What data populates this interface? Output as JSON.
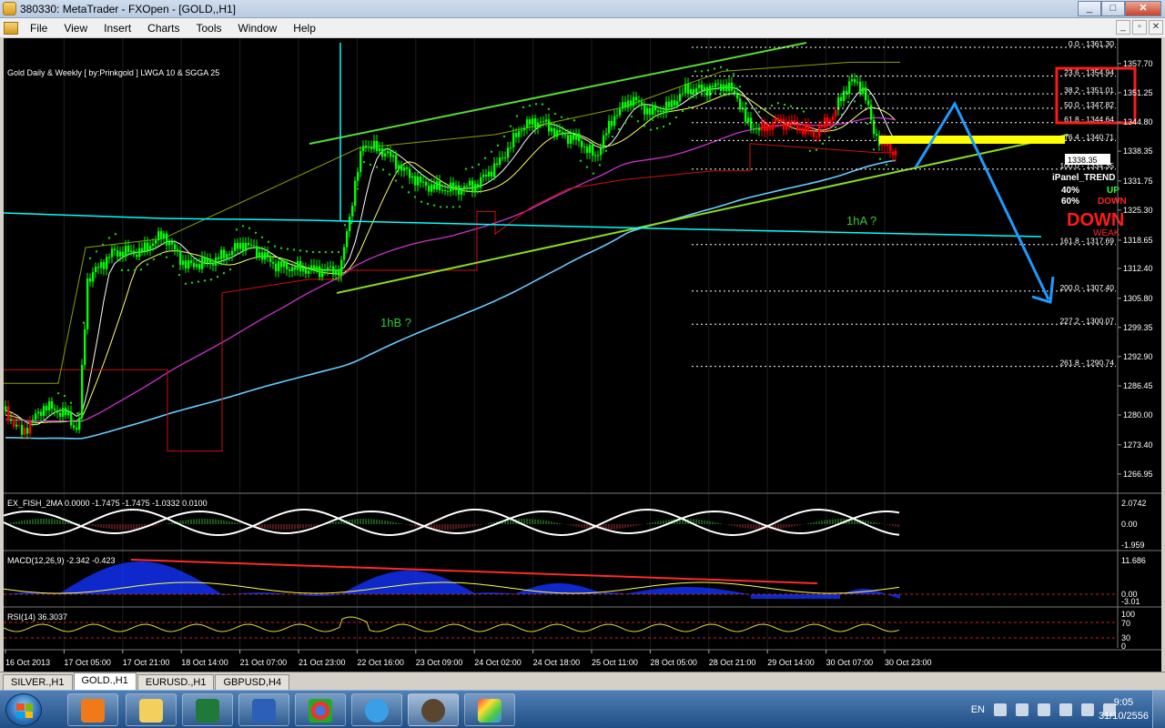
{
  "window": {
    "title": "380330: MetaTrader - FXOpen - [GOLD,,H1]",
    "buttons": [
      "_",
      "□",
      "✕"
    ]
  },
  "menu": {
    "items": [
      "File",
      "View",
      "Insert",
      "Charts",
      "Tools",
      "Window",
      "Help"
    ],
    "child_buttons": [
      "_",
      "▫",
      "✕"
    ]
  },
  "chart": {
    "header": "Gold Daily & Weekly [ by:Prinkgold ] LWGA 10 & SGGA 25",
    "current_price": "1338.35",
    "price_scale": [
      "1357.70",
      "1351.25",
      "1344.80",
      "1338.35",
      "1331.75",
      "1325.30",
      "1318.65",
      "1312.40",
      "1305.80",
      "1299.35",
      "1292.90",
      "1286.45",
      "1280.00",
      "1273.40",
      "1266.95"
    ],
    "fib_levels": [
      {
        "label": "0.0 - 1361.30"
      },
      {
        "label": "23.6 - 1354.94"
      },
      {
        "label": "38.2 - 1351.01"
      },
      {
        "label": "50.0 - 1347.82"
      },
      {
        "label": "61.8 - 1344.64"
      },
      {
        "label": "76.4 - 1340.71"
      },
      {
        "label": "100.0 - 1334.35"
      },
      {
        "label": "161.8 - 1317.69"
      },
      {
        "label": "200.0 - 1307.40"
      },
      {
        "label": "227.2 - 1300.07"
      },
      {
        "label": "261.8 - 1290.74"
      }
    ],
    "wave_labels": {
      "one_hb": "1hB ?",
      "one_ha": "1hA ?"
    },
    "trend_panel": {
      "title": "iPanel_TREND",
      "up_pct": "40%",
      "up_label": "UP",
      "down_pct": "60%",
      "down_label": "DOWN",
      "big_label": "DOWN",
      "strength": "WEAK"
    },
    "time_axis": [
      "16 Oct 2013",
      "17 Oct 05:00",
      "17 Oct 21:00",
      "18 Oct 14:00",
      "21 Oct 07:00",
      "21 Oct 23:00",
      "22 Oct 16:00",
      "23 Oct 09:00",
      "24 Oct 02:00",
      "24 Oct 18:00",
      "25 Oct 11:00",
      "28 Oct 05:00",
      "28 Oct 21:00",
      "29 Oct 14:00",
      "30 Oct 07:00",
      "30 Oct 23:00"
    ],
    "colors": {
      "bull": "#00ff00",
      "bear": "#ff0000",
      "support": "#00ffff",
      "trend": "#66dd33",
      "fib": "#ffffff",
      "arrow": "#1e9bff",
      "highlight": "#ffff00"
    }
  },
  "fisher": {
    "label": "EX_FISH_2MA 0.0000 -1.7475 -1.7475 -1.0332 0.0100",
    "scale": [
      "2.0742",
      "0.00",
      "-1.959"
    ]
  },
  "macd": {
    "label": "MACD(12,26,9) -2.342 -0.423",
    "scale": [
      "11.686",
      "0.00",
      "-3.01"
    ]
  },
  "rsi": {
    "label": "RSI(14) 36.3037",
    "scale": [
      "100",
      "70",
      "30",
      "0"
    ]
  },
  "tabs": [
    "SILVER.,H1",
    "GOLD.,H1",
    "EURUSD.,H1",
    "GBPUSD,H4"
  ],
  "active_tab": "GOLD.,H1",
  "taskbar": {
    "lang": "EN",
    "time": "9:05",
    "date": "31/10/2556"
  }
}
